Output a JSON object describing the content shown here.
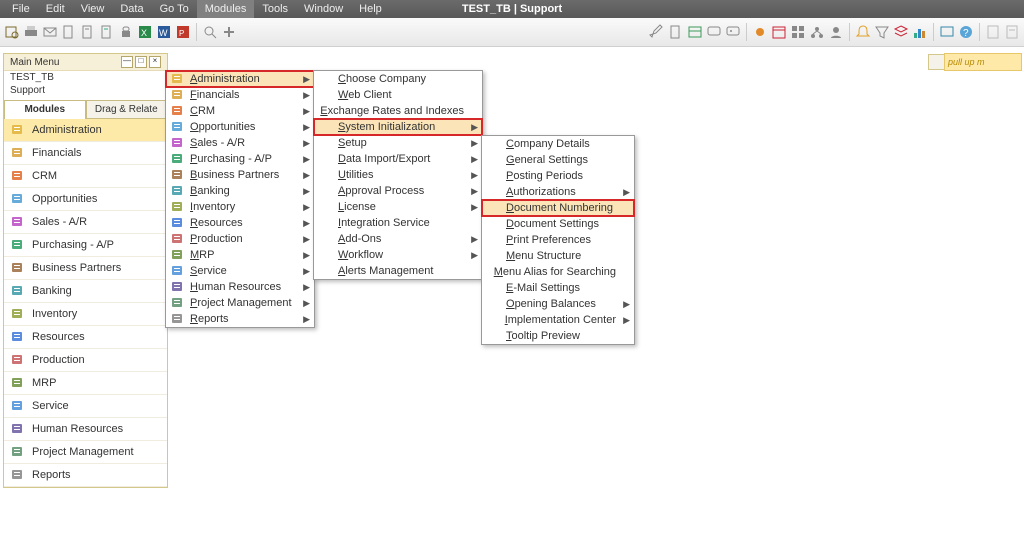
{
  "app_title": "TEST_TB | Support",
  "menubar": {
    "items": [
      "File",
      "Edit",
      "View",
      "Data",
      "Go To",
      "Modules",
      "Tools",
      "Window",
      "Help"
    ],
    "active": 5
  },
  "panel": {
    "title": "Main Menu",
    "l1": "TEST_TB",
    "l2": "Support"
  },
  "tabs": {
    "a": "Modules",
    "b": "Drag & Relate"
  },
  "sidebar": [
    "Administration",
    "Financials",
    "CRM",
    "Opportunities",
    "Sales - A/R",
    "Purchasing - A/P",
    "Business Partners",
    "Banking",
    "Inventory",
    "Resources",
    "Production",
    "MRP",
    "Service",
    "Human Resources",
    "Project Management",
    "Reports"
  ],
  "menu1": [
    {
      "l": "Administration",
      "a": true,
      "hl": true
    },
    {
      "l": "Financials",
      "a": true
    },
    {
      "l": "CRM",
      "a": true
    },
    {
      "l": "Opportunities",
      "a": true
    },
    {
      "l": "Sales - A/R",
      "a": true
    },
    {
      "l": "Purchasing - A/P",
      "a": true
    },
    {
      "l": "Business Partners",
      "a": true
    },
    {
      "l": "Banking",
      "a": true
    },
    {
      "l": "Inventory",
      "a": true
    },
    {
      "l": "Resources",
      "a": true
    },
    {
      "l": "Production",
      "a": true
    },
    {
      "l": "MRP",
      "a": true
    },
    {
      "l": "Service",
      "a": true
    },
    {
      "l": "Human Resources",
      "a": true
    },
    {
      "l": "Project Management",
      "a": true
    },
    {
      "l": "Reports",
      "a": true
    }
  ],
  "menu2": [
    {
      "l": "Choose Company"
    },
    {
      "l": "Web Client"
    },
    {
      "l": "Exchange Rates and Indexes"
    },
    {
      "l": "System Initialization",
      "a": true,
      "hl": true
    },
    {
      "l": "Setup",
      "a": true
    },
    {
      "l": "Data Import/Export",
      "a": true
    },
    {
      "l": "Utilities",
      "a": true
    },
    {
      "l": "Approval Process",
      "a": true
    },
    {
      "l": "License",
      "a": true
    },
    {
      "l": "Integration Service"
    },
    {
      "l": "Add-Ons",
      "a": true
    },
    {
      "l": "Workflow",
      "a": true
    },
    {
      "l": "Alerts Management"
    }
  ],
  "menu3": [
    {
      "l": "Company Details"
    },
    {
      "l": "General Settings"
    },
    {
      "l": "Posting Periods"
    },
    {
      "l": "Authorizations",
      "a": true
    },
    {
      "l": "Document Numbering",
      "hl": true
    },
    {
      "l": "Document Settings"
    },
    {
      "l": "Print Preferences"
    },
    {
      "l": "Menu Structure"
    },
    {
      "l": "Menu Alias for Searching"
    },
    {
      "l": "E-Mail Settings"
    },
    {
      "l": "Opening Balances",
      "a": true
    },
    {
      "l": "Implementation Center",
      "a": true
    },
    {
      "l": "Tooltip Preview"
    }
  ],
  "hint": "pull up m",
  "icons": {
    "colors": [
      "#e1b43c",
      "#d8a038",
      "#e26a2c",
      "#4b9cd3",
      "#b84ac2",
      "#2a9d64",
      "#9c6b3f",
      "#3c9aa8",
      "#8fa03b",
      "#3f78d8",
      "#c45a5a",
      "#6b8f3c",
      "#4a8fd8",
      "#6b5aa0",
      "#5a8f6b",
      "#848484"
    ]
  }
}
